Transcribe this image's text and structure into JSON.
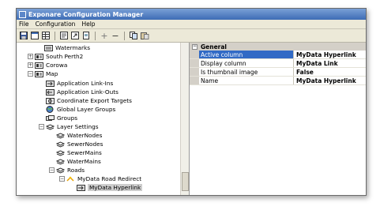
{
  "window": {
    "title": "Exponare Configuration Manager"
  },
  "menu": [
    "File",
    "Configuration",
    "Help"
  ],
  "toolbar": {
    "icons": [
      "save-icon",
      "window-icon",
      "grid-icon",
      "open-icon",
      "export-icon",
      "document-icon",
      "add-icon",
      "remove-icon",
      "copy-icon",
      "paste-icon"
    ],
    "add_glyph": "+",
    "remove_glyph": "−"
  },
  "tree": {
    "items": [
      {
        "label": "Watermarks",
        "icon": "layer-icon",
        "expander": ""
      },
      {
        "label": "South Perth2",
        "icon": "map-icon",
        "expander": "+"
      },
      {
        "label": "Corowa",
        "icon": "map-icon",
        "expander": "+"
      },
      {
        "label": "Map",
        "icon": "map-icon",
        "expander": "−"
      },
      {
        "label": "Application Link-Ins",
        "icon": "link-icon",
        "expander": ""
      },
      {
        "label": "Application Link-Outs",
        "icon": "link-icon",
        "expander": ""
      },
      {
        "label": "Coordinate Export Targets",
        "icon": "target-icon",
        "expander": ""
      },
      {
        "label": "Global Layer Groups",
        "icon": "globe-icon",
        "expander": ""
      },
      {
        "label": "Groups",
        "icon": "group-icon",
        "expander": ""
      },
      {
        "label": "Layer Settings",
        "icon": "layers-icon",
        "expander": "−"
      },
      {
        "label": "WaterNodes",
        "icon": "layer-icon",
        "expander": ""
      },
      {
        "label": "SewerNodes",
        "icon": "layer-icon",
        "expander": ""
      },
      {
        "label": "SewerMains",
        "icon": "layer-icon",
        "expander": ""
      },
      {
        "label": "WaterMains",
        "icon": "layer-icon",
        "expander": ""
      },
      {
        "label": "Roads",
        "icon": "layer-icon",
        "expander": "−"
      },
      {
        "label": "MyData Road Redirect",
        "icon": "redirect-icon",
        "expander": "−"
      },
      {
        "label": "MyData Hyperlink",
        "icon": "hyperlink-icon",
        "expander": ""
      }
    ]
  },
  "properties": {
    "category": "General",
    "category_expander": "−",
    "rows": [
      {
        "name": "Active column",
        "value": "MyData Hyperlink"
      },
      {
        "name": "Display column",
        "value": "MyData Link"
      },
      {
        "name": "Is thumbnail image",
        "value": "False"
      },
      {
        "name": "Name",
        "value": "MyData Hyperlink"
      }
    ]
  },
  "colors": {
    "title_start": "#7aa0d6",
    "title_end": "#3e6cb5",
    "selection": "#316ac5",
    "chrome": "#ece9d8"
  }
}
